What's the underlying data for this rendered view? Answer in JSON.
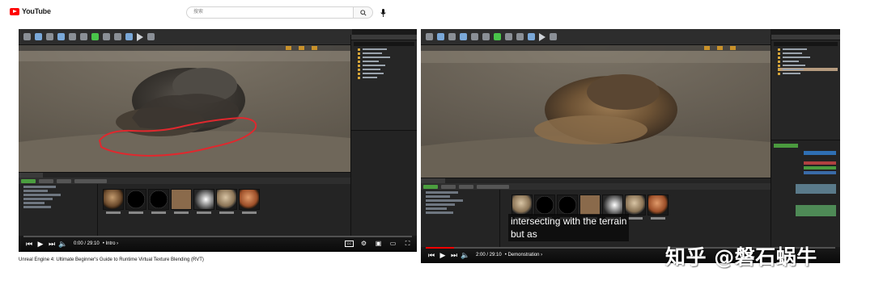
{
  "header": {
    "logo_text": "YouTube",
    "search_placeholder": "搜索",
    "search_icon": "search-icon",
    "mic_icon": "microphone-icon",
    "brand_color": "#ff0000"
  },
  "player1": {
    "time": "0:00 / 29:10",
    "chapter": "• Intro ›",
    "progress_fraction": 0.0,
    "title": "Unreal Engine 4: Ultimate Beginner's Guide to Runtime Virtual Texture Blending (RVT)",
    "annotation_color": "#e0282e"
  },
  "player2": {
    "time": "2:00 / 29:10",
    "chapter": "• Demonstration ›",
    "progress_fraction": 0.07,
    "caption_line1": "intersecting with the terrain",
    "caption_line2": "but as"
  },
  "controls": {
    "prev_icon": "skip-previous-icon",
    "play_icon": "play-icon",
    "next_icon": "skip-next-icon",
    "volume_icon": "volume-icon",
    "cc_icon": "subtitles-icon",
    "cc_label": "CC",
    "settings_icon": "gear-icon",
    "miniplayer_icon": "miniplayer-icon",
    "theater_icon": "theater-mode-icon",
    "fullscreen_icon": "fullscreen-icon"
  },
  "watermark": "知乎 @磐石蜗牛"
}
